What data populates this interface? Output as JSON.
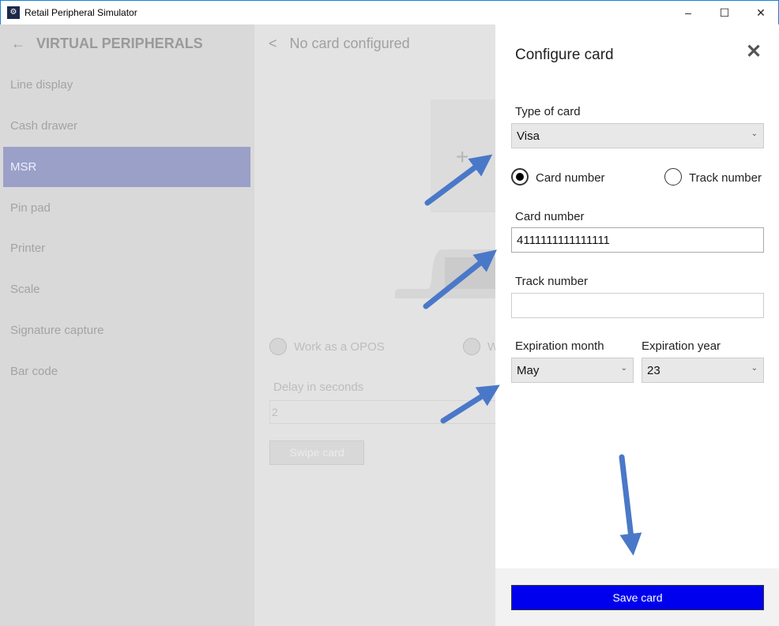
{
  "window": {
    "title": "Retail Peripheral Simulator",
    "minimize": "–",
    "maximize": "☐",
    "close": "✕"
  },
  "sidebar": {
    "back": "←",
    "title": "VIRTUAL PERIPHERALS",
    "items": [
      {
        "label": "Line display"
      },
      {
        "label": "Cash drawer"
      },
      {
        "label": "MSR",
        "selected": true
      },
      {
        "label": "Pin pad"
      },
      {
        "label": "Printer"
      },
      {
        "label": "Scale"
      },
      {
        "label": "Signature capture"
      },
      {
        "label": "Bar code"
      }
    ]
  },
  "middle": {
    "back": "<",
    "title": "No card configured",
    "add": "+",
    "opos_label": "Work as a OPOS",
    "other_label": "W",
    "delay_label": "Delay in seconds",
    "delay_value": "2",
    "swipe_label": "Swipe card"
  },
  "panel": {
    "title": "Configure card",
    "close": "✕",
    "type_label": "Type of card",
    "type_value": "Visa",
    "radio_card": "Card number",
    "radio_track": "Track number",
    "selected_radio": "Card number",
    "card_label": "Card number",
    "card_value": "4111111111111111",
    "track_label": "Track number",
    "track_value": "",
    "month_label": "Expiration month",
    "month_value": "May",
    "year_label": "Expiration year",
    "year_value": "23",
    "save_label": "Save card",
    "chevron": "⌄"
  },
  "colors": {
    "accent": "#0000ee",
    "arrow": "#4a78c8",
    "selected_item": "#9aa0c8"
  }
}
